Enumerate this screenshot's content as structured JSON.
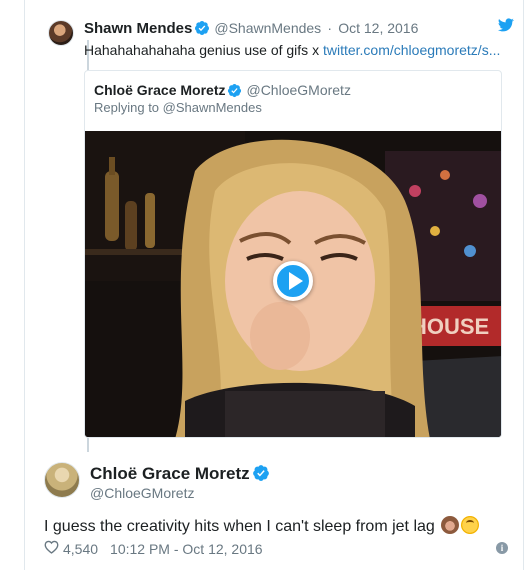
{
  "parent_tweet": {
    "name": "Shawn Mendes",
    "handle": "@ShawnMendes",
    "separator": "·",
    "date": "Oct 12, 2016",
    "text": "Hahahahahahaha genius use of gifs x ",
    "link": "twitter.com/chloegmoretz/s..."
  },
  "quoted_tweet": {
    "name": "Chloë Grace Moretz",
    "handle": "@ChloeGMoretz",
    "replying_to": "Replying to @ShawnMendes"
  },
  "main_tweet": {
    "name": "Chloë Grace Moretz",
    "handle": "@ChloeGMoretz",
    "text": "I guess the creativity hits when I can't sleep from jet lag",
    "emojis": [
      "speak-no-evil-monkey",
      "upside-down-face"
    ],
    "likes": "4,540",
    "timestamp": "10:12 PM - Oct 12, 2016"
  },
  "colors": {
    "link": "#2b7bb9",
    "verified": "#1da1f2",
    "muted": "#697882",
    "play_button": "#1da1f2"
  },
  "icons": {
    "verified": "verified-badge-icon",
    "bird": "twitter-bird-icon",
    "play": "play-icon",
    "heart": "heart-icon",
    "info": "info-icon"
  }
}
